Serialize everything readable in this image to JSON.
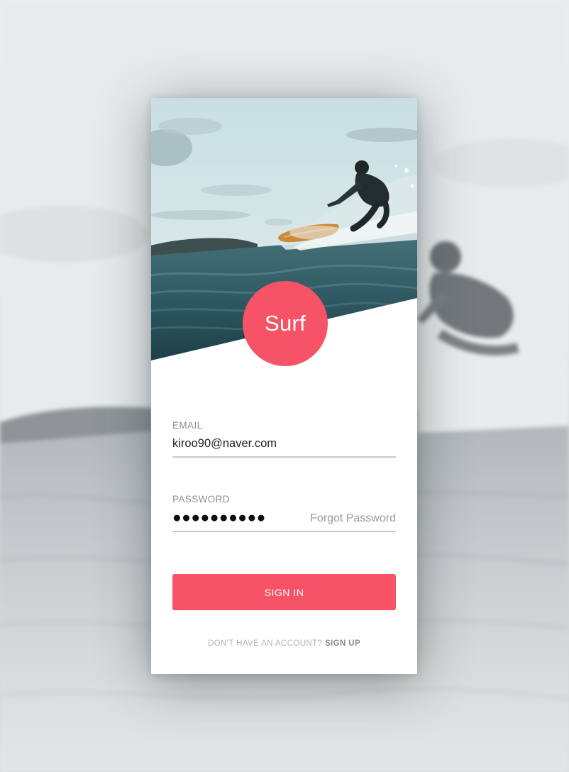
{
  "app": {
    "logo_text": "Surf"
  },
  "form": {
    "email": {
      "label": "EMAIL",
      "value": "kiroo90@naver.com"
    },
    "password": {
      "label": "PASSWORD",
      "masked_value": "●●●●●●●●●●",
      "forgot_label": "Forgot Password"
    },
    "sign_in_label": "SIGN IN"
  },
  "footer": {
    "prompt": "DON'T HAVE AN ACCOUNT?",
    "sign_up_label": "SIGN UP"
  },
  "colors": {
    "accent": "#f65466",
    "background": "#ffffff",
    "muted_text": "#8e8e8e",
    "divider": "#c9c9c9"
  },
  "icons": {
    "hero": "surfer-photo"
  }
}
